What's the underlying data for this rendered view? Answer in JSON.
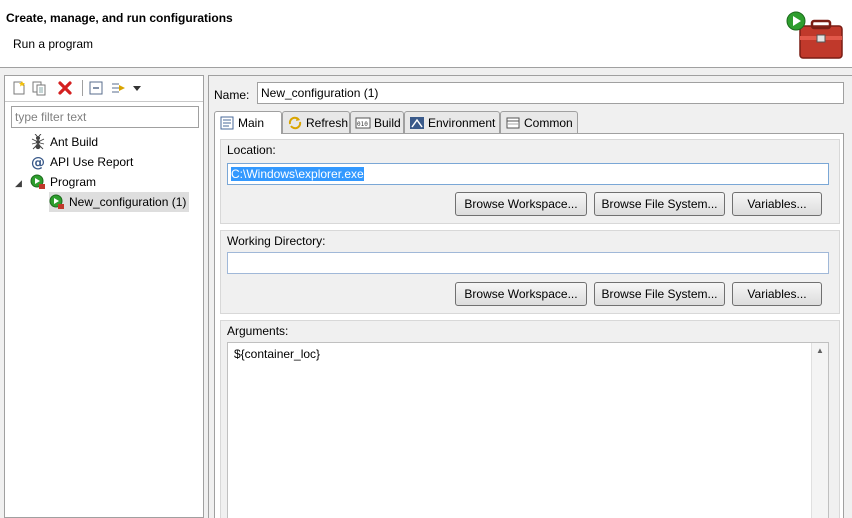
{
  "header": {
    "title": "Create, manage, and run configurations",
    "subtitle": "Run a program"
  },
  "toolbar": {
    "icons": [
      "new-configuration-icon",
      "duplicate-icon",
      "delete-icon",
      "collapse-all-icon",
      "filter-icon",
      "dropdown-arrow-icon"
    ]
  },
  "filter": {
    "placeholder": "type filter text",
    "value": ""
  },
  "tree": {
    "items": [
      {
        "label": "Ant Build",
        "icon": "ant-icon"
      },
      {
        "label": "API Use Report",
        "icon": "api-report-icon"
      },
      {
        "label": "Program",
        "icon": "program-icon",
        "expanded": true
      },
      {
        "label": "New_configuration (1)",
        "icon": "program-config-icon",
        "selected": true
      }
    ]
  },
  "config": {
    "name_label": "Name:",
    "name_value": "New_configuration (1)"
  },
  "tabs": [
    {
      "label": "Main",
      "active": true
    },
    {
      "label": "Refresh"
    },
    {
      "label": "Build"
    },
    {
      "label": "Environment"
    },
    {
      "label": "Common"
    }
  ],
  "main": {
    "location": {
      "label": "Location:",
      "value": "C:\\Windows\\explorer.exe",
      "buttons": [
        "Browse Workspace...",
        "Browse File System...",
        "Variables..."
      ]
    },
    "working_directory": {
      "label": "Working Directory:",
      "value": "",
      "buttons": [
        "Browse Workspace...",
        "Browse File System...",
        "Variables..."
      ]
    },
    "arguments": {
      "label": "Arguments:",
      "value": "${container_loc}"
    }
  },
  "colors": {
    "selection": "#3399ff",
    "tree_selection": "#dedede",
    "accent_green": "#2e9e2e",
    "delete_red": "#d42020",
    "toolbox_red": "#c0392b"
  }
}
